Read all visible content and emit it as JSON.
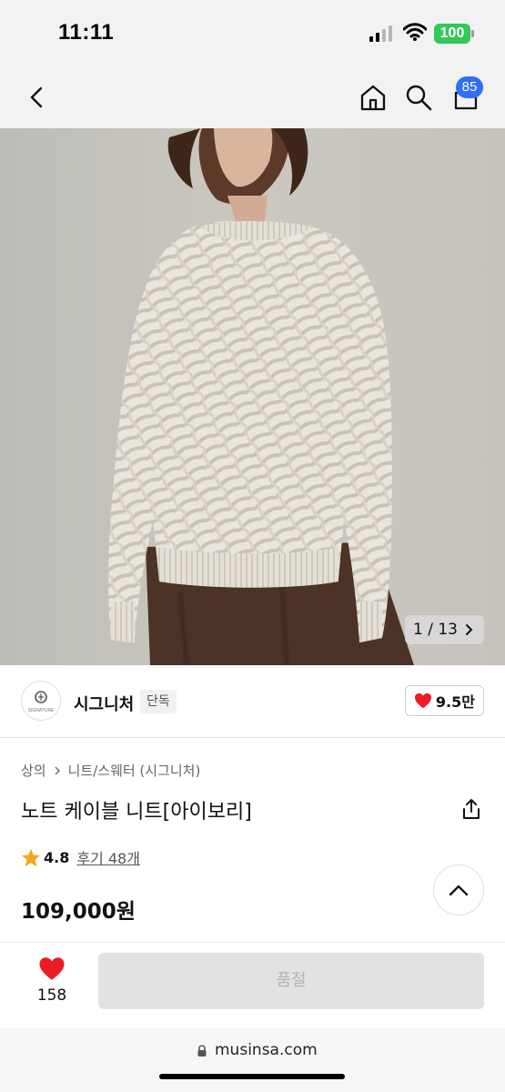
{
  "status_bar": {
    "time": "11:11",
    "battery": "100"
  },
  "nav": {
    "cart_badge": "85"
  },
  "gallery": {
    "counter": "1 / 13"
  },
  "brand": {
    "name": "시그니처",
    "tag": "단독",
    "logo_text": "SIGNATURE",
    "likes": "9.5만"
  },
  "product": {
    "breadcrumb": [
      "상의",
      "니트/스웨터 (시그니처)"
    ],
    "title": "노트 케이블 니트[아이보리]",
    "rating": "4.8",
    "review_label": "후기 48개",
    "price": "109,000원"
  },
  "purchase": {
    "heart_count": "158",
    "button_label": "품절"
  },
  "browser": {
    "url": "musinsa.com"
  },
  "colors": {
    "like": "#ed1c24",
    "star": "#f5a623",
    "badge": "#2f6ef5",
    "battery": "#34c759",
    "soldout_bg": "#e2e2e2"
  },
  "icons": [
    "back-icon",
    "home-icon",
    "search-icon",
    "cart-icon",
    "chevron-right-icon",
    "heart-icon",
    "share-icon",
    "star-icon",
    "chevron-up-icon",
    "lock-icon"
  ]
}
